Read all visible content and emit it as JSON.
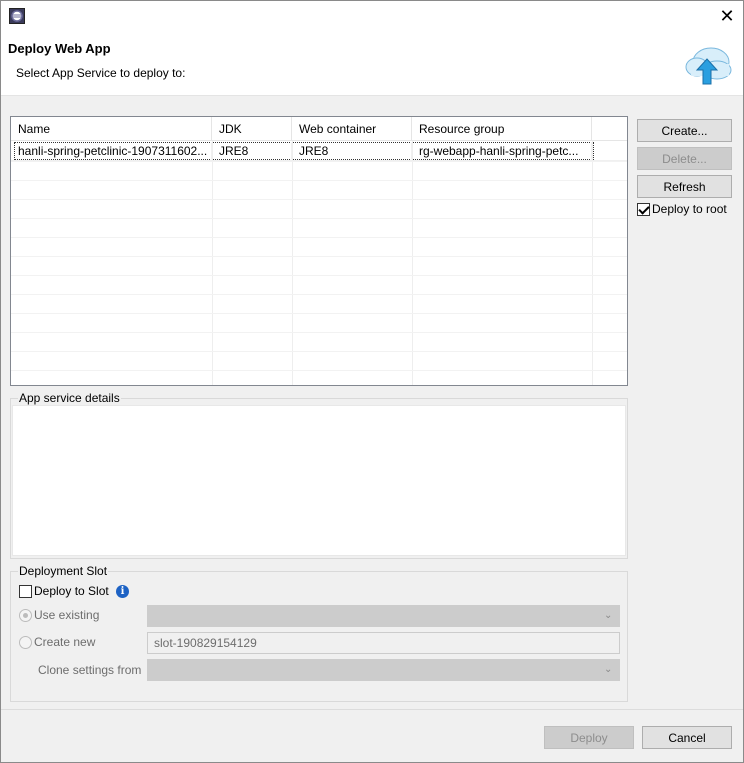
{
  "window": {
    "close_glyph": "✕"
  },
  "banner": {
    "title": "Deploy Web App",
    "subtitle": "Select App Service to deploy to:",
    "icon": "cloud-upload-icon"
  },
  "table": {
    "columns": [
      "Name",
      "JDK",
      "Web container",
      "Resource group"
    ],
    "rows": [
      [
        "hanli-spring-petclinic-1907311602...",
        "JRE8",
        "JRE8",
        "rg-webapp-hanli-spring-petc..."
      ]
    ]
  },
  "side_buttons": {
    "create": "Create...",
    "delete": "Delete...",
    "refresh": "Refresh",
    "deploy_to_root": "Deploy to root"
  },
  "details": {
    "label": "App service details"
  },
  "slot": {
    "group_label": "Deployment Slot",
    "deploy_to_slot": "Deploy to Slot",
    "use_existing": "Use existing",
    "create_new": "Create new",
    "new_slot_value": "slot-190829154129",
    "clone_settings_from": "Clone settings from"
  },
  "footer": {
    "deploy": "Deploy",
    "cancel": "Cancel"
  }
}
